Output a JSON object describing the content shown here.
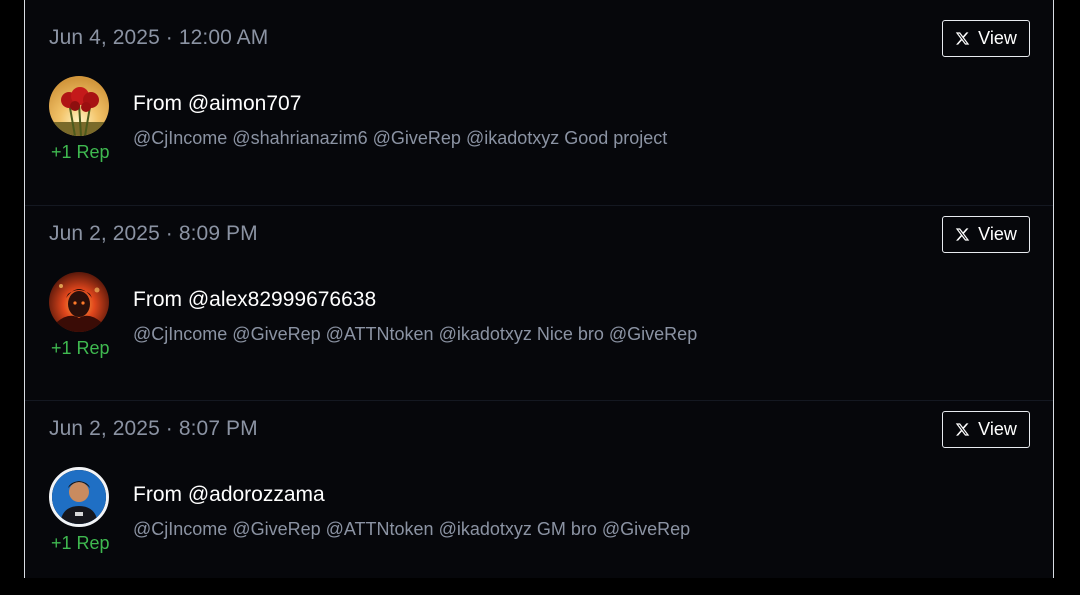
{
  "entries": [
    {
      "date": "Jun 4, 2025 · 12:00 AM",
      "view_label": "View",
      "from": "From @aimon707",
      "message": "@CjIncome @shahrianazim6 @GiveRep @ikadotxyz Good project",
      "rep": "+1 Rep"
    },
    {
      "date": "Jun 2, 2025 · 8:09 PM",
      "view_label": "View",
      "from": "From @alex82999676638",
      "message": "@CjIncome @GiveRep @ATTNtoken @ikadotxyz Nice bro @GiveRep",
      "rep": "+1 Rep"
    },
    {
      "date": "Jun 2, 2025 · 8:07 PM",
      "view_label": "View",
      "from": "From @adorozzama",
      "message": "@CjIncome @GiveRep @ATTNtoken @ikadotxyz GM bro @GiveRep",
      "rep": "+1 Rep"
    }
  ],
  "colors": {
    "rep_green": "#3fb950",
    "muted_text": "#8b93a3",
    "panel_bg": "#06070b"
  },
  "icons": {
    "view_button": "x-logo-icon"
  }
}
